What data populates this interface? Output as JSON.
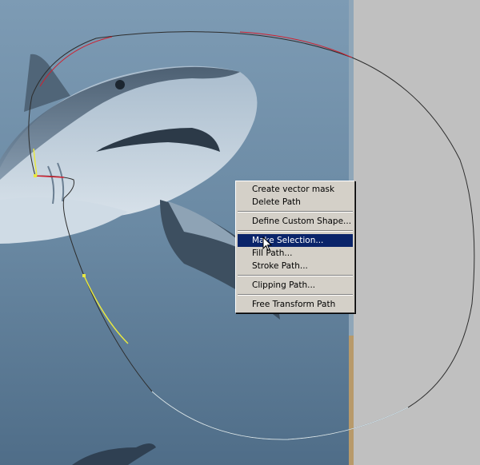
{
  "context_menu": {
    "items": [
      {
        "label": "Create vector mask"
      },
      {
        "label": "Delete Path"
      },
      {
        "separator": true
      },
      {
        "label": "Define Custom Shape..."
      },
      {
        "separator": true
      },
      {
        "label": "Make Selection...",
        "highlighted": true
      },
      {
        "label": "Fill Path..."
      },
      {
        "label": "Stroke Path..."
      },
      {
        "separator": true
      },
      {
        "label": "Clipping Path..."
      },
      {
        "separator": true
      },
      {
        "label": "Free Transform Path"
      }
    ]
  },
  "colors": {
    "menu_background": "#d4d0c8",
    "menu_highlight": "#0a246a",
    "workspace_gray": "#c0c0c0",
    "water_blue": "#6f8ea8",
    "path_stroke": "#333333"
  },
  "icons": {
    "cursor": "arrow-pointer-icon"
  }
}
